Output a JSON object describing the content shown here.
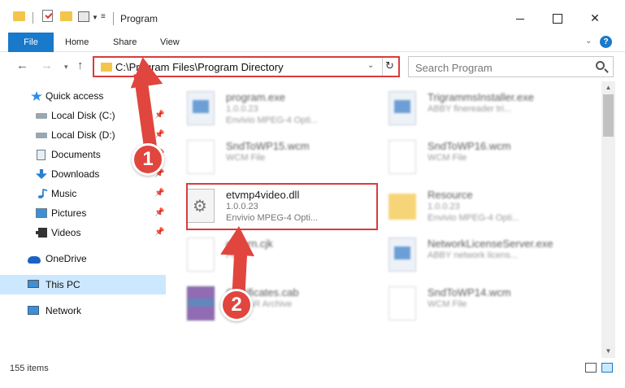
{
  "window": {
    "title": "Program"
  },
  "ribbon": {
    "file": "File",
    "home": "Home",
    "share": "Share",
    "view": "View",
    "help": "?"
  },
  "nav": {
    "address": "C:\\Program Files\\Program Directory",
    "search_placeholder": "Search Program"
  },
  "sidebar": {
    "items": [
      {
        "label": "Quick access",
        "icon": "star-icon"
      },
      {
        "label": "Local Disk (C:)",
        "icon": "drive-icon",
        "pinned": true
      },
      {
        "label": "Local Disk (D:)",
        "icon": "drive-icon",
        "pinned": true
      },
      {
        "label": "Documents",
        "icon": "documents-icon",
        "pinned": true
      },
      {
        "label": "Downloads",
        "icon": "download-icon",
        "pinned": true
      },
      {
        "label": "Music",
        "icon": "music-icon",
        "pinned": true
      },
      {
        "label": "Pictures",
        "icon": "pictures-icon",
        "pinned": true
      },
      {
        "label": "Videos",
        "icon": "videos-icon",
        "pinned": true
      },
      {
        "label": "OneDrive",
        "icon": "onedrive-icon"
      },
      {
        "label": "This PC",
        "icon": "pc-icon",
        "selected": true
      },
      {
        "label": "Network",
        "icon": "network-icon"
      }
    ]
  },
  "files": [
    {
      "name": "program.exe",
      "line2": "1.0.0.23",
      "line3": "Envivio MPEG-4 Opti...",
      "icon": "exe-icon"
    },
    {
      "name": "TrigrammsInstaller.exe",
      "line2": "ABBY finereader tri...",
      "line3": "",
      "icon": "exe-icon"
    },
    {
      "name": "SndToWP15.wcm",
      "line2": "WCM File",
      "line3": "",
      "icon": "file-icon"
    },
    {
      "name": "SndToWP16.wcm",
      "line2": "WCM File",
      "line3": "",
      "icon": "file-icon"
    },
    {
      "name": "etvmp4video.dll",
      "line2": "1.0.0.23",
      "line3": "Envivio MPEG-4 Opti...",
      "icon": "dll-icon"
    },
    {
      "name": "Resource",
      "line2": "1.0.0.23",
      "line3": "Envivio MPEG-4 Opti...",
      "icon": "folder-icon"
    },
    {
      "name": "etKorn.cjk",
      "line2": "File",
      "line3": "",
      "icon": "file-icon"
    },
    {
      "name": "NetworkLicenseServer.exe",
      "line2": "ABBY network licens...",
      "line3": "",
      "icon": "exe-icon"
    },
    {
      "name": "Certificates.cab",
      "line2": "WinRAR Archive",
      "line3": "",
      "icon": "archive-icon"
    },
    {
      "name": "SndToWP14.wcm",
      "line2": "WCM File",
      "line3": "",
      "icon": "file-icon"
    }
  ],
  "status": {
    "item_count": "155 items"
  },
  "annotations": {
    "step1": "1",
    "step2": "2",
    "accent": "#e0463e"
  }
}
